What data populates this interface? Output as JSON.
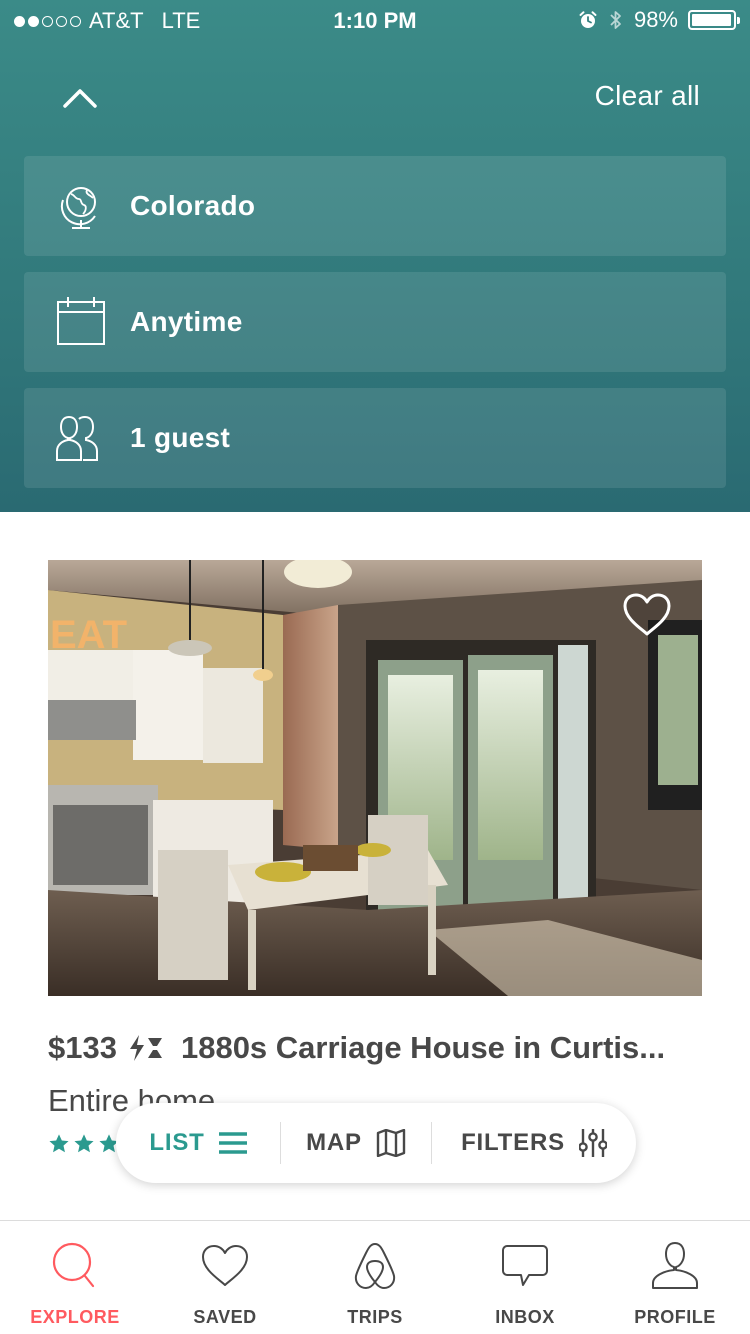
{
  "status_bar": {
    "carrier": "AT&T",
    "network": "LTE",
    "time": "1:10 PM",
    "battery": "98%",
    "battery_level": 0.98,
    "signal_bars_filled": 2,
    "signal_bars_total": 5,
    "icons": [
      "alarm-icon",
      "bluetooth-icon",
      "battery-icon"
    ]
  },
  "header": {
    "clear_all": "Clear all",
    "collapse_icon": "chevron-up-icon"
  },
  "search": {
    "location": {
      "icon": "globe-icon",
      "label": "Colorado"
    },
    "dates": {
      "icon": "calendar-icon",
      "label": "Anytime"
    },
    "guests": {
      "icon": "guests-icon",
      "label": "1 guest"
    }
  },
  "listing": {
    "price": "$133",
    "instant_book_icon": "instant-book-icon",
    "title": "1880s Carriage House in Curtis...",
    "type": "Entire home",
    "stars_visible": 3,
    "saved": false,
    "photo_description_icon": "photo"
  },
  "view_toggle": {
    "list": "LIST",
    "map": "MAP",
    "filters": "FILTERS",
    "active": "list"
  },
  "tabbar": {
    "items": [
      {
        "label": "EXPLORE",
        "icon": "search-icon",
        "active": true
      },
      {
        "label": "SAVED",
        "icon": "heart-icon",
        "active": false
      },
      {
        "label": "TRIPS",
        "icon": "airbnb-logo-icon",
        "active": false
      },
      {
        "label": "INBOX",
        "icon": "message-icon",
        "active": false
      },
      {
        "label": "PROFILE",
        "icon": "person-icon",
        "active": false
      }
    ]
  },
  "colors": {
    "header_teal": "#357f80",
    "accent_teal": "#2b9a8f",
    "active_tab": "#ff5a5f",
    "text_dark": "#484848"
  }
}
